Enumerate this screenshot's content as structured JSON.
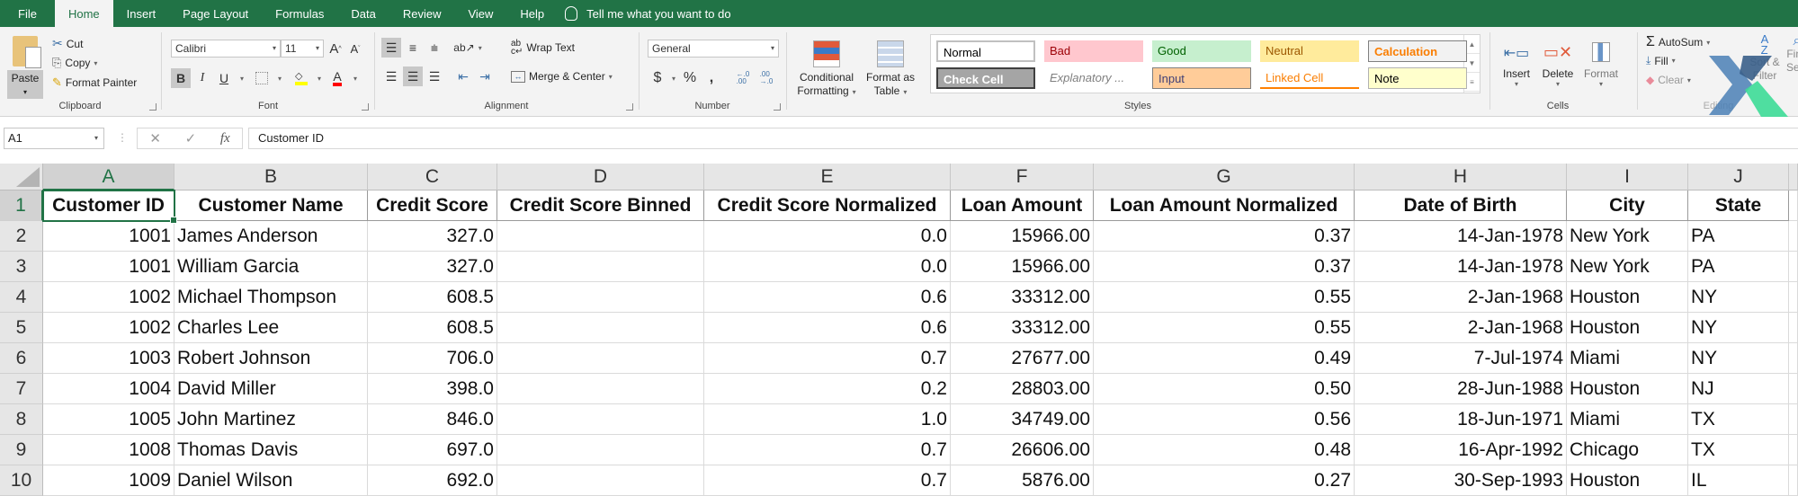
{
  "tabs": {
    "items": [
      "File",
      "Home",
      "Insert",
      "Page Layout",
      "Formulas",
      "Data",
      "Review",
      "View",
      "Help"
    ],
    "active": "Home",
    "tell_me": "Tell me what you want to do"
  },
  "ribbon": {
    "clipboard": {
      "label": "Clipboard",
      "paste": "Paste",
      "cut": "Cut",
      "copy": "Copy",
      "format_painter": "Format Painter"
    },
    "font": {
      "label": "Font",
      "font_name": "Calibri",
      "font_size": "11",
      "bold": "B",
      "italic": "I",
      "underline": "U",
      "grow": "A",
      "shrink": "A",
      "font_color": "A",
      "fill_color_hex": "#ffff00",
      "font_color_hex": "#ff0000"
    },
    "alignment": {
      "label": "Alignment",
      "wrap_text": "Wrap Text",
      "merge_center": "Merge & Center"
    },
    "number": {
      "label": "Number",
      "format": "General",
      "currency": "$",
      "percent": "%",
      "comma": ",",
      "inc_decimal": "←.0 .00",
      "dec_decimal": ".00 →.0"
    },
    "styles": {
      "label": "Styles",
      "conditional_formatting_1": "Conditional",
      "conditional_formatting_2": "Formatting",
      "format_as_table_1": "Format as",
      "format_as_table_2": "Table",
      "cells": [
        {
          "name": "Normal",
          "bg": "#ffffff",
          "fg": "#000000"
        },
        {
          "name": "Bad",
          "bg": "#ffc7ce",
          "fg": "#9c0006"
        },
        {
          "name": "Good",
          "bg": "#c6efce",
          "fg": "#006100"
        },
        {
          "name": "Neutral",
          "bg": "#ffeb9c",
          "fg": "#9c5700"
        },
        {
          "name": "Calculation",
          "bg": "#f2f2f2",
          "fg": "#fa7d00"
        },
        {
          "name": "Check Cell",
          "bg": "#a5a5a5",
          "fg": "#ffffff"
        },
        {
          "name": "Explanatory ...",
          "bg": "#ffffff",
          "fg": "#7f7f7f"
        },
        {
          "name": "Input",
          "bg": "#ffcc99",
          "fg": "#3f3f76"
        },
        {
          "name": "Linked Cell",
          "bg": "#ffffff",
          "fg": "#fa7d00"
        },
        {
          "name": "Note",
          "bg": "#ffffcc",
          "fg": "#000000"
        }
      ]
    },
    "cells": {
      "label": "Cells",
      "insert": "Insert",
      "delete": "Delete",
      "format": "Format"
    },
    "editing": {
      "label": "Editing",
      "autosum": "AutoSum",
      "fill": "Fill",
      "clear": "Clear",
      "sort_filter_1": "Sort &",
      "sort_filter_2": "Filter",
      "find_1": "Find",
      "find_2": "Sele"
    }
  },
  "formula_bar": {
    "name_box": "A1",
    "cancel": "✕",
    "enter": "✓",
    "fx": "fx",
    "value": "Customer ID"
  },
  "sheet": {
    "columns": [
      "A",
      "B",
      "C",
      "D",
      "E",
      "F",
      "G",
      "H",
      "I",
      "J"
    ],
    "row_numbers": [
      "1",
      "2",
      "3",
      "4",
      "5",
      "6",
      "7",
      "8",
      "9",
      "10"
    ],
    "selected_cell": "A1",
    "headers": [
      "Customer ID",
      "Customer Name",
      "Credit Score",
      "Credit Score Binned",
      "Credit Score Normalized",
      "Loan Amount",
      "Loan Amount Normalized",
      "Date of Birth",
      "City",
      "State"
    ],
    "rows": [
      [
        "1001",
        "James Anderson",
        "327.0",
        "",
        "0.0",
        "15966.00",
        "0.37",
        "14-Jan-1978",
        "New York",
        "PA"
      ],
      [
        "1001",
        "William Garcia",
        "327.0",
        "",
        "0.0",
        "15966.00",
        "0.37",
        "14-Jan-1978",
        "New York",
        "PA"
      ],
      [
        "1002",
        "Michael Thompson",
        "608.5",
        "",
        "0.6",
        "33312.00",
        "0.55",
        "2-Jan-1968",
        "Houston",
        "NY"
      ],
      [
        "1002",
        "Charles Lee",
        "608.5",
        "",
        "0.6",
        "33312.00",
        "0.55",
        "2-Jan-1968",
        "Houston",
        "NY"
      ],
      [
        "1003",
        "Robert Johnson",
        "706.0",
        "",
        "0.7",
        "27677.00",
        "0.49",
        "7-Jul-1974",
        "Miami",
        "NY"
      ],
      [
        "1004",
        "David Miller",
        "398.0",
        "",
        "0.2",
        "28803.00",
        "0.50",
        "28-Jun-1988",
        "Houston",
        "NJ"
      ],
      [
        "1005",
        "John Martinez",
        "846.0",
        "",
        "1.0",
        "34749.00",
        "0.56",
        "18-Jun-1971",
        "Miami",
        "TX"
      ],
      [
        "1008",
        "Thomas Davis",
        "697.0",
        "",
        "0.7",
        "26606.00",
        "0.48",
        "16-Apr-1992",
        "Chicago",
        "TX"
      ],
      [
        "1009",
        "Daniel Wilson",
        "692.0",
        "",
        "0.7",
        "5876.00",
        "0.27",
        "30-Sep-1993",
        "Houston",
        "IL"
      ]
    ]
  }
}
